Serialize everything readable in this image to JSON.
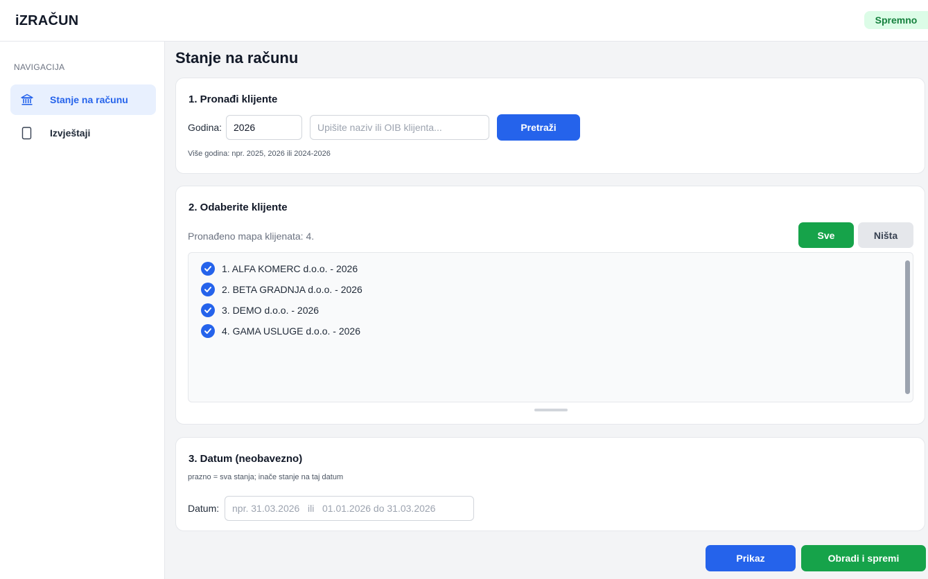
{
  "header": {
    "app_title": "iZRAČUN",
    "status": "Spremno"
  },
  "sidebar": {
    "heading": "NAVIGACIJA",
    "items": [
      {
        "label": "Stanje na računu",
        "icon": "bank-icon",
        "active": true
      },
      {
        "label": "Izvještaji",
        "icon": "document-icon",
        "active": false
      }
    ]
  },
  "main": {
    "page_title": "Stanje na računu",
    "section1": {
      "title": "1.  Pronađi klijente",
      "year_label": "Godina:",
      "year_value": "2026",
      "search_placeholder": "Upišite naziv ili OIB klijenta...",
      "search_button": "Pretraži",
      "hint": "Više godina: npr.  2025, 2026  ili  2024-2026"
    },
    "section2": {
      "title": "2.  Odaberite klijente",
      "found_text": "Pronađeno mapa klijenata: 4.",
      "all_button": "Sve",
      "none_button": "Ništa",
      "clients": [
        {
          "label": "1.  ALFA KOMERC d.o.o. - 2026",
          "checked": true
        },
        {
          "label": "2.  BETA GRADNJA d.o.o. - 2026",
          "checked": true
        },
        {
          "label": "3.  DEMO d.o.o. - 2026",
          "checked": true
        },
        {
          "label": "4.  GAMA USLUGE d.o.o. - 2026",
          "checked": true
        }
      ]
    },
    "section3": {
      "title": "3.  Datum  (neobavezno)",
      "hint": "prazno = sva stanja; inače stanje na taj datum",
      "date_label": "Datum:",
      "date_placeholder": "npr. 31.03.2026   ili   01.01.2026 do 31.03.2026"
    },
    "actions": {
      "show_button": "Prikaz",
      "process_button": "Obradi i spremi"
    }
  },
  "colors": {
    "accent": "#2563eb",
    "success": "#16a34a",
    "status_bg": "#dcfce7"
  }
}
